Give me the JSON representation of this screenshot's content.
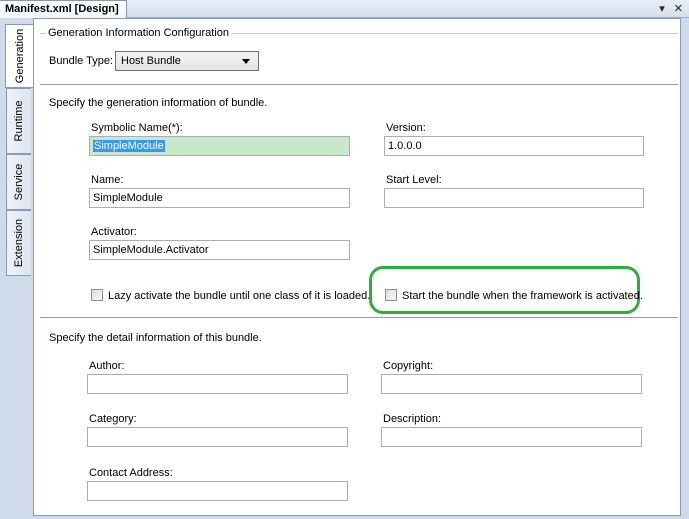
{
  "window": {
    "tab_title": "Manifest.xml [Design]",
    "dropdown_glyph": "▾",
    "close_glyph": "✕"
  },
  "side_tabs": [
    "Generation",
    "Runtime",
    "Service",
    "Extension"
  ],
  "config": {
    "group_title": "Generation Information Configuration",
    "bundle_type_label": "Bundle Type:",
    "bundle_type_value": "Host Bundle"
  },
  "generation": {
    "heading": "Specify the generation information of bundle.",
    "symbolic_name_label": "Symbolic Name(*):",
    "symbolic_name_value": "SimpleModule",
    "version_label": "Version:",
    "version_value": "1.0.0.0",
    "name_label": "Name:",
    "name_value": "SimpleModule",
    "start_level_label": "Start Level:",
    "start_level_value": "",
    "activator_label": "Activator:",
    "activator_value": "SimpleModule.Activator",
    "lazy_label": "Lazy activate the bundle until one class of it is loaded.",
    "start_label": "Start the bundle when the framework is activated."
  },
  "detail": {
    "heading": "Specify the detail information of this bundle.",
    "author_label": "Author:",
    "copyright_label": "Copyright:",
    "category_label": "Category:",
    "description_label": "Description:",
    "contact_label": "Contact Address:"
  },
  "colors": {
    "highlight": "#2fae38",
    "focused_field": "#c9e8c9",
    "selection": "#3399ff"
  }
}
